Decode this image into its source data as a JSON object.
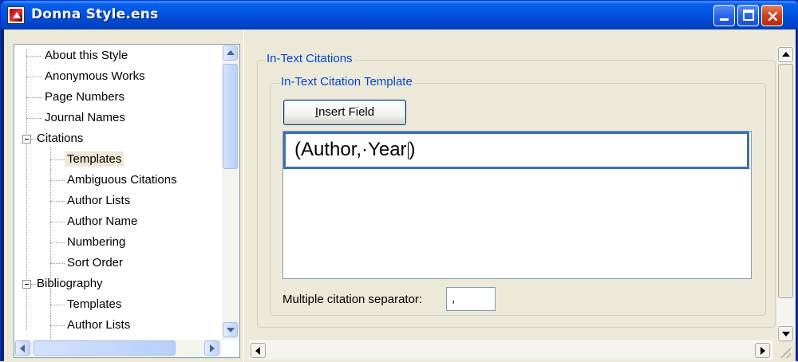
{
  "window": {
    "title": "Donna Style.ens",
    "controls": {
      "minimize": "minimize",
      "maximize": "maximize",
      "close": "×"
    }
  },
  "tree": {
    "items": [
      {
        "label": "About this Style"
      },
      {
        "label": "Anonymous Works"
      },
      {
        "label": "Page Numbers"
      },
      {
        "label": "Journal Names"
      },
      {
        "label": "Citations"
      },
      {
        "label": "Templates"
      },
      {
        "label": "Ambiguous Citations"
      },
      {
        "label": "Author Lists"
      },
      {
        "label": "Author Name"
      },
      {
        "label": "Numbering"
      },
      {
        "label": "Sort Order"
      },
      {
        "label": "Bibliography"
      },
      {
        "label": "Templates"
      },
      {
        "label": "Author Lists"
      }
    ],
    "expanded_groups": [
      "Citations",
      "Bibliography"
    ],
    "selected_item": "Templates"
  },
  "main": {
    "section_title": "In-Text Citations",
    "template_group_title": "In-Text Citation Template",
    "insert_button_label": "Insert Field",
    "insert_button_accesskey": "I",
    "insert_button_rest": "nsert Field",
    "template_text_before_caret": "(Author,·Year",
    "template_text_after_caret": ")",
    "separator_label": "Multiple citation separator:",
    "separator_value": ","
  }
}
